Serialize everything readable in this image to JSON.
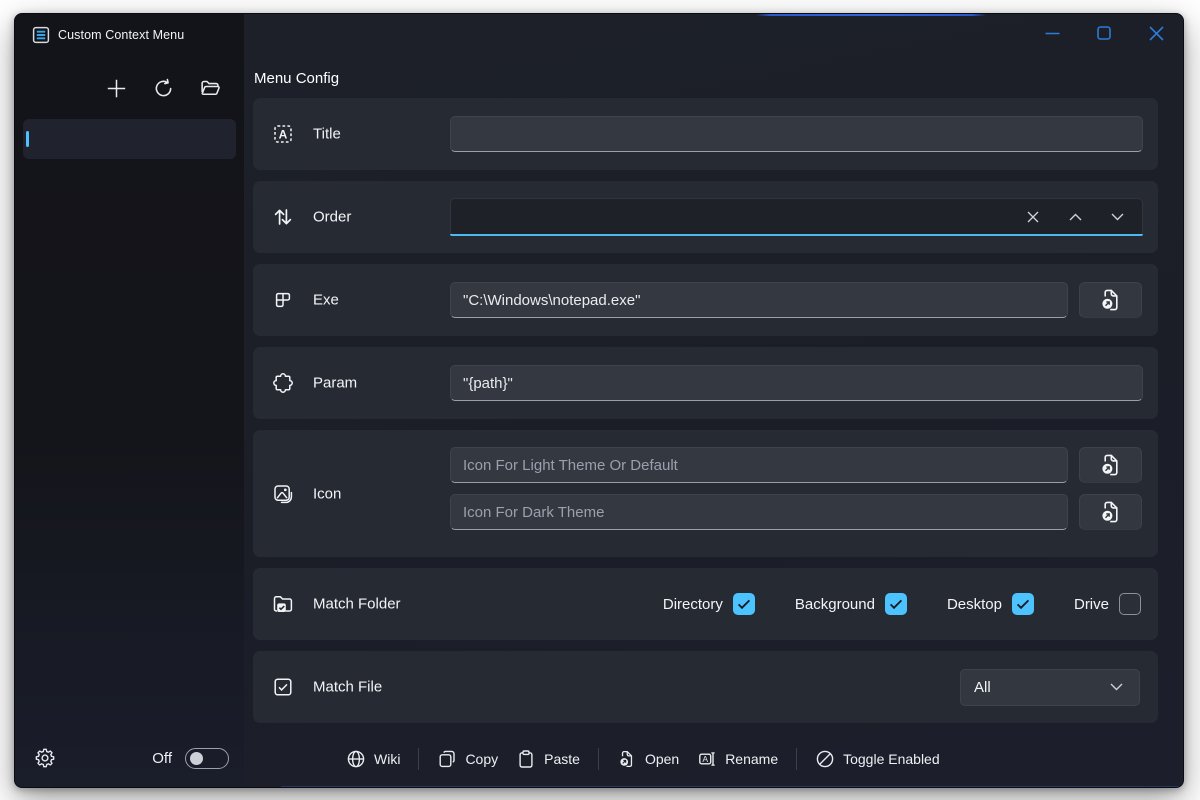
{
  "titlebar": {
    "app_title": "Custom Context Menu",
    "minimize": "minimize",
    "maximize": "maximize",
    "close": "close"
  },
  "sidebar": {
    "toolbar": {
      "add": "add",
      "refresh": "refresh",
      "open_folder": "open folder"
    },
    "items": [
      {
        "label": "",
        "selected": true
      }
    ],
    "footer": {
      "settings": "settings",
      "toggle_label": "Off",
      "toggle_on": false
    }
  },
  "main": {
    "heading": "Menu Config",
    "rows": {
      "title": {
        "label": "Title",
        "value": "",
        "placeholder": ""
      },
      "order": {
        "label": "Order",
        "value": "",
        "focused": true
      },
      "exe": {
        "label": "Exe",
        "value": "\"C:\\Windows\\notepad.exe\""
      },
      "param": {
        "label": "Param",
        "value": "\"{path}\""
      },
      "icon": {
        "label": "Icon",
        "light_placeholder": "Icon For Light Theme Or Default",
        "dark_placeholder": "Icon For Dark Theme"
      },
      "match_folder": {
        "label": "Match Folder",
        "options": [
          {
            "label": "Directory",
            "checked": true
          },
          {
            "label": "Background",
            "checked": true
          },
          {
            "label": "Desktop",
            "checked": true
          },
          {
            "label": "Drive",
            "checked": false
          }
        ]
      },
      "match_file": {
        "label": "Match File",
        "selected": "All"
      }
    },
    "commands": [
      {
        "label": "Wiki",
        "icon": "globe"
      },
      {
        "label": "Copy",
        "icon": "copy"
      },
      {
        "label": "Paste",
        "icon": "paste"
      },
      {
        "label": "Open",
        "icon": "open-file"
      },
      {
        "label": "Rename",
        "icon": "rename"
      },
      {
        "label": "Toggle Enabled",
        "icon": "toggle-enabled"
      }
    ]
  },
  "colors": {
    "accent": "#4cc2ff",
    "caption_buttons": "#2b7bd9",
    "card": "#262a33",
    "main_background": "#1b1e27",
    "sidebar_background": "#141519",
    "focus_underline": "#4cb9f2"
  }
}
